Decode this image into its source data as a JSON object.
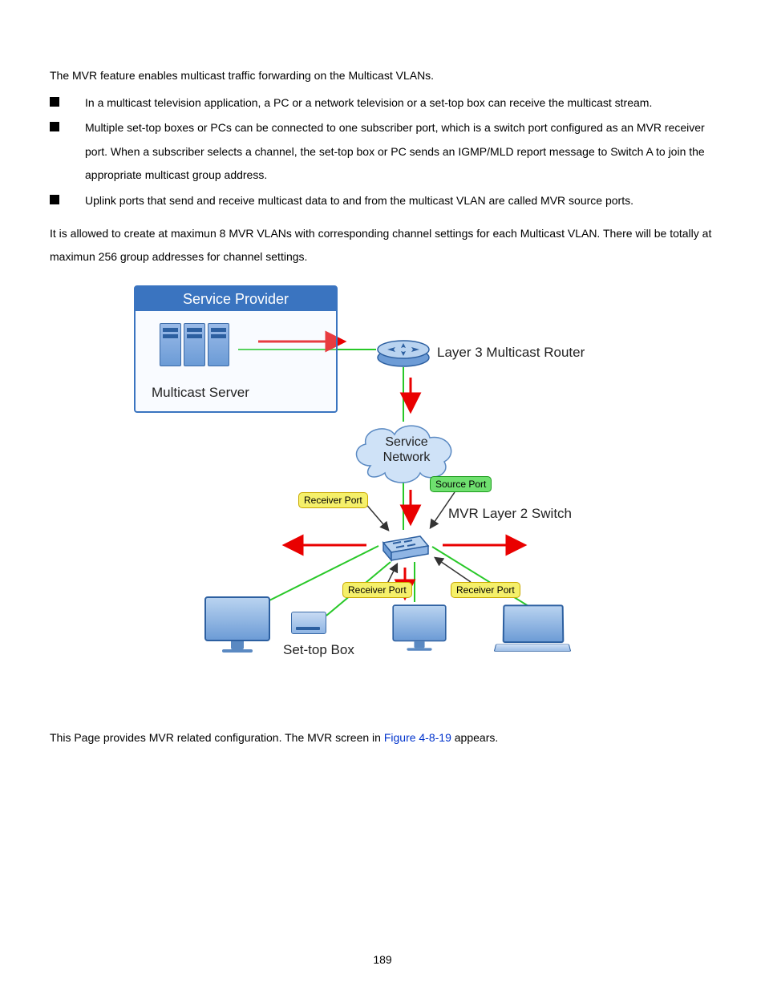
{
  "intro": "The MVR feature enables multicast traffic forwarding on the Multicast VLANs.",
  "bullets": [
    "In a multicast television application, a PC or a network television or a set-top box can receive the multicast stream.",
    "Multiple set-top boxes or PCs can be connected to one subscriber port, which is a switch port configured as an MVR receiver port. When a subscriber selects a channel, the set-top box or PC sends an IGMP/MLD report message to Switch A to join the appropriate multicast group address.",
    "Uplink ports that send and receive multicast data to and from the multicast VLAN are called MVR source ports."
  ],
  "maxnote": "It is allowed to create at maximun 8 MVR VLANs with corresponding channel settings for each Multicast VLAN. There will be totally at maximun 256 group addresses for channel settings.",
  "config_prefix": "This Page provides MVR related configuration. The MVR screen in ",
  "config_figref": "Figure 4-8-19",
  "config_suffix": " appears.",
  "diagram": {
    "service_provider": "Service Provider",
    "multicast_server": "Multicast Server",
    "l3_router": "Layer 3 Multicast Router",
    "service_network_line1": "Service",
    "service_network_line2": "Network",
    "source_port": "Source Port",
    "receiver_port": "Receiver Port",
    "mvr_switch": "MVR Layer 2 Switch",
    "settop_box": "Set-top Box"
  },
  "page_number": "189"
}
